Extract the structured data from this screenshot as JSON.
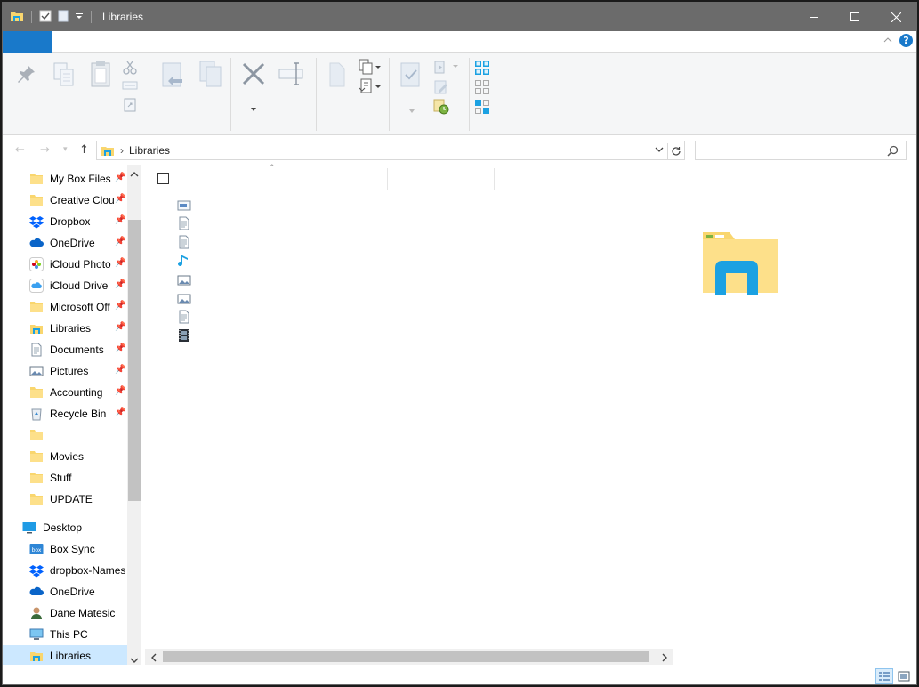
{
  "window": {
    "title": "Libraries"
  },
  "address": {
    "path": "Libraries",
    "separator": "›"
  },
  "search": {
    "placeholder": "",
    "value": ""
  },
  "navigation": {
    "items": [
      {
        "label": "My Box Files",
        "icon": "folder-icon",
        "pinned": true
      },
      {
        "label": "Creative Clou",
        "icon": "folder-icon",
        "pinned": true
      },
      {
        "label": "Dropbox",
        "icon": "dropbox-icon",
        "pinned": true
      },
      {
        "label": "OneDrive",
        "icon": "onedrive-icon",
        "pinned": true
      },
      {
        "label": "iCloud Photo",
        "icon": "icloud-photos-icon",
        "pinned": true
      },
      {
        "label": "iCloud Drive",
        "icon": "icloud-drive-icon",
        "pinned": true
      },
      {
        "label": "Microsoft Off",
        "icon": "folder-icon",
        "pinned": true
      },
      {
        "label": "Libraries",
        "icon": "libraries-icon",
        "pinned": true
      },
      {
        "label": "Documents",
        "icon": "documents-icon",
        "pinned": true
      },
      {
        "label": "Pictures",
        "icon": "pictures-icon",
        "pinned": true
      },
      {
        "label": "Accounting",
        "icon": "folder-icon",
        "pinned": true
      },
      {
        "label": "Recycle Bin",
        "icon": "recycle-bin-icon",
        "pinned": true
      },
      {
        "label": "",
        "icon": "folder-icon",
        "pinned": false
      },
      {
        "label": "Movies",
        "icon": "folder-icon",
        "pinned": false
      },
      {
        "label": "Stuff",
        "icon": "folder-icon",
        "pinned": false
      },
      {
        "label": "UPDATE",
        "icon": "folder-icon",
        "pinned": false
      }
    ],
    "tree": [
      {
        "label": "Desktop",
        "icon": "desktop-icon"
      },
      {
        "label": "Box Sync",
        "icon": "box-icon"
      },
      {
        "label": "dropbox-Names",
        "icon": "dropbox-icon"
      },
      {
        "label": "OneDrive",
        "icon": "onedrive-icon"
      },
      {
        "label": "Dane Matesic",
        "icon": "user-icon"
      },
      {
        "label": "This PC",
        "icon": "this-pc-icon"
      },
      {
        "label": "Libraries",
        "icon": "libraries-icon",
        "selected": true
      }
    ]
  },
  "content": {
    "library_items": [
      {
        "icon": "camera-roll-icon"
      },
      {
        "icon": "documents-icon"
      },
      {
        "icon": "documents-icon"
      },
      {
        "icon": "music-icon"
      },
      {
        "icon": "pictures-icon"
      },
      {
        "icon": "pictures-icon"
      },
      {
        "icon": "documents-icon"
      },
      {
        "icon": "videos-icon"
      }
    ]
  },
  "pin_glyph": "📌",
  "colors": {
    "titlebar": "#6b6b6b",
    "accent": "#1979ca",
    "folder": "#f9d66e",
    "selected": "#cce8ff"
  }
}
